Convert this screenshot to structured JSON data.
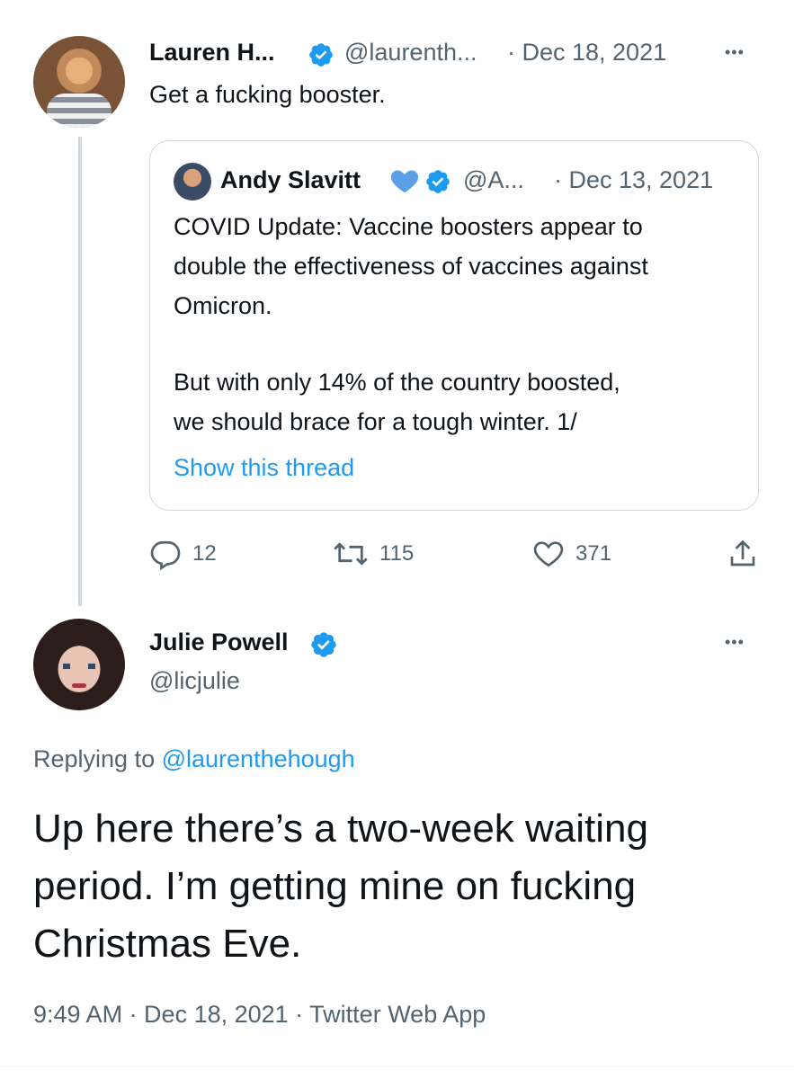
{
  "tweet1": {
    "name": "Lauren H...",
    "handle": "@laurenth...",
    "date": "· Dec 18, 2021",
    "text": "Get a fucking booster.",
    "more": "•••",
    "quoted": {
      "name": "Andy Slavitt",
      "handle": "@A...",
      "date": "· Dec 13, 2021",
      "p1_l1": "COVID Update: Vaccine boosters appear to",
      "p1_l2": "double the effectiveness of vaccines against",
      "p1_l3": "Omicron.",
      "p2_l1": "But with only 14% of the country boosted,",
      "p2_l2": "we should brace for a tough winter. 1/",
      "show_thread": "Show this thread"
    },
    "actions": {
      "replies": "12",
      "retweets": "115",
      "likes": "371"
    }
  },
  "tweet2": {
    "name": "Julie Powell",
    "handle": "@licjulie",
    "more": "•••",
    "replying_prefix": "Replying to",
    "replying_handle": "@laurenthehough",
    "text_l1": "Up here there’s a two-week waiting",
    "text_l2": "period. I’m getting mine on fucking",
    "text_l3": "Christmas Eve.",
    "meta": "9:49 AM · Dec 18, 2021 · Twitter Web App"
  },
  "colors": {
    "accent": "#1d9bf0",
    "muted": "#536471",
    "border": "#cfd9de"
  }
}
